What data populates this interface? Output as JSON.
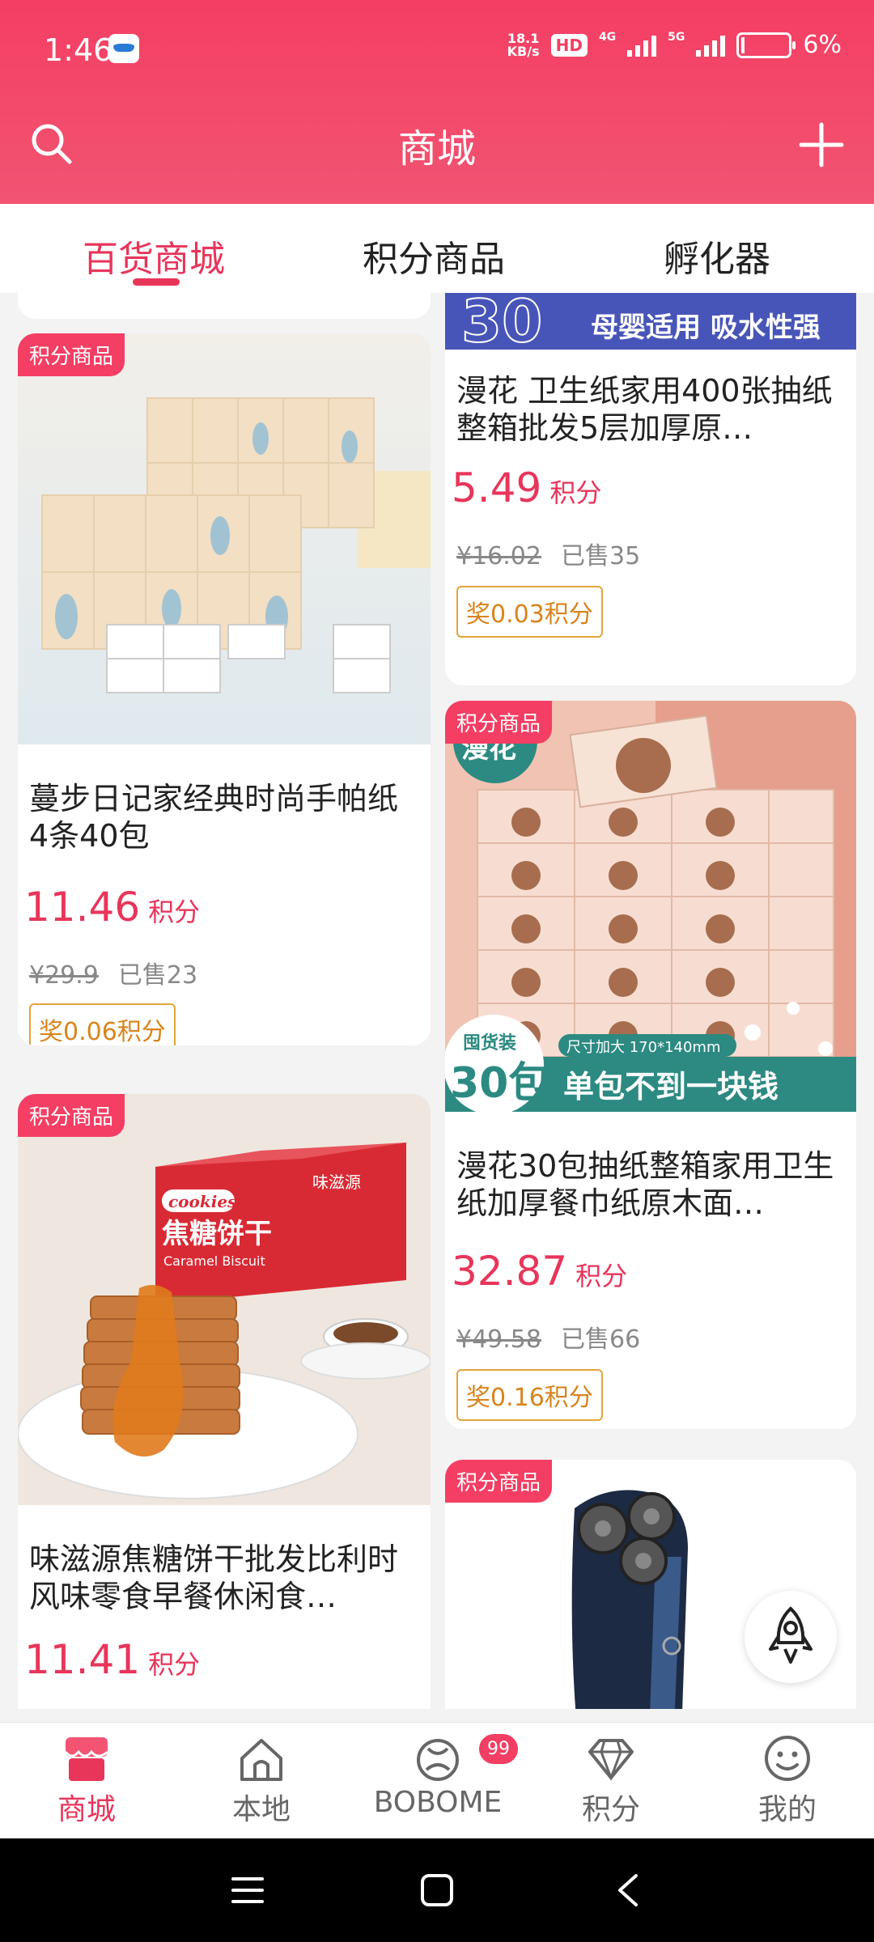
{
  "status_bar": {
    "time": "1:46",
    "speed_value": "18.1",
    "speed_unit": "KB/s",
    "hd_label": "HD",
    "net1": "4G",
    "net2": "5G",
    "battery": "6%"
  },
  "header": {
    "title": "商城"
  },
  "tabs": [
    {
      "label": "百货商城",
      "active": true
    },
    {
      "label": "积分商品",
      "active": false
    },
    {
      "label": "孵化器",
      "active": false
    }
  ],
  "products": [
    {
      "badge": "积分商品",
      "name": "蔓步日记家经典时尚手帕纸4条40包",
      "price": "11.46",
      "price_unit": "积分",
      "old_price": "¥29.9",
      "sold": "已售23",
      "reward": "奖0.06积分"
    },
    {
      "name": "漫花 卫生纸家用400张抽纸整箱批发5层加厚原…",
      "banner_number": "30",
      "banner_text": "母婴适用 吸水性强",
      "price": "5.49",
      "price_unit": "积分",
      "old_price": "¥16.02",
      "sold": "已售35",
      "reward": "奖0.03积分"
    },
    {
      "badge": "积分商品",
      "image_brand": "漫花",
      "image_tag": "囤货装",
      "image_count": "30包",
      "image_size": "尺寸加大 170*140mm",
      "image_slogan": "单包不到一块钱",
      "name": "漫花30包抽纸整箱家用卫生纸加厚餐巾纸原木面…",
      "price": "32.87",
      "price_unit": "积分",
      "old_price": "¥49.58",
      "sold": "已售66",
      "reward": "奖0.16积分"
    },
    {
      "badge": "积分商品",
      "image_box_brand": "cookies",
      "image_box_title": "焦糖饼干",
      "image_box_sub": "Caramel Biscuit",
      "image_brand": "味滋源",
      "name": "味滋源焦糖饼干批发比利时风味零食早餐休闲食…",
      "price": "11.41",
      "price_unit": "积分"
    },
    {
      "badge": "积分商品"
    }
  ],
  "bottom_nav": [
    {
      "label": "商城",
      "icon": "shop-icon",
      "active": true
    },
    {
      "label": "本地",
      "icon": "home-icon",
      "active": false
    },
    {
      "label": "BOBOME",
      "icon": "bobome-icon",
      "active": false,
      "badge": "99"
    },
    {
      "label": "积分",
      "icon": "diamond-icon",
      "active": false
    },
    {
      "label": "我的",
      "icon": "smile-icon",
      "active": false
    }
  ],
  "colors": {
    "accent": "#e8355a",
    "header": "#f43e63",
    "reward": "#d9831c"
  }
}
